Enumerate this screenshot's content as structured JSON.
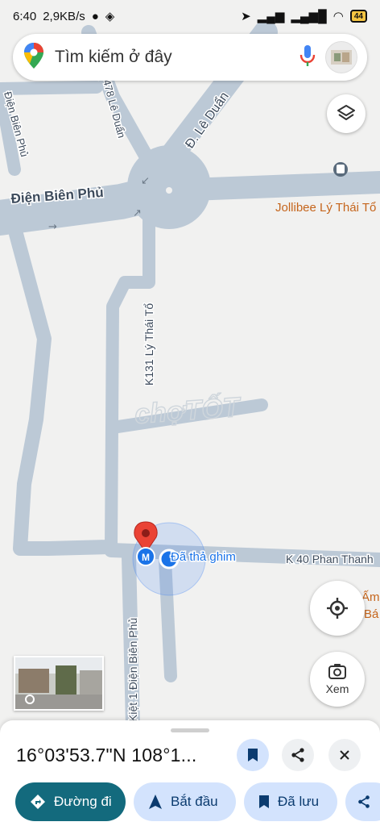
{
  "status": {
    "time": "6:40",
    "speed": "2,9KB/s",
    "battery": "44"
  },
  "search": {
    "placeholder": "Tìm kiếm ở đây"
  },
  "map": {
    "streets": {
      "dien_bien_phu": "Điện Biên Phủ",
      "dien_bien_phu_vertical": "Điện Biên Phủ",
      "le_duan_478": "478 Lê Duẩn",
      "le_duan": "Đ. Lê Duẩn",
      "ly_thai_to": "K131 Lý Thái Tổ",
      "phan_thanh": "K 40 Phan Thanh",
      "kiet_1": "Kiệt 1 Điện Biên Phủ"
    },
    "places": {
      "jollibee": "Jollibee Lý Thái Tổ",
      "right_edge_1": "Ấm",
      "right_edge_2": "Bá"
    },
    "pin_label": "Đã thả ghim",
    "watermark": "chợTỐT"
  },
  "controls": {
    "explore_label": "Xem"
  },
  "sheet": {
    "coords": "16°03'53.7\"N 108°1...",
    "chips": [
      {
        "label": "Đường đi"
      },
      {
        "label": "Bắt đầu"
      },
      {
        "label": "Đã lưu"
      }
    ]
  },
  "colors": {
    "road": "#bcc9d6",
    "primary": "#0b57d0",
    "chip_dark": "#136a7d",
    "chip_light": "#d3e3fd",
    "pin": "#ea4335",
    "poi_text": "#c5651c"
  }
}
